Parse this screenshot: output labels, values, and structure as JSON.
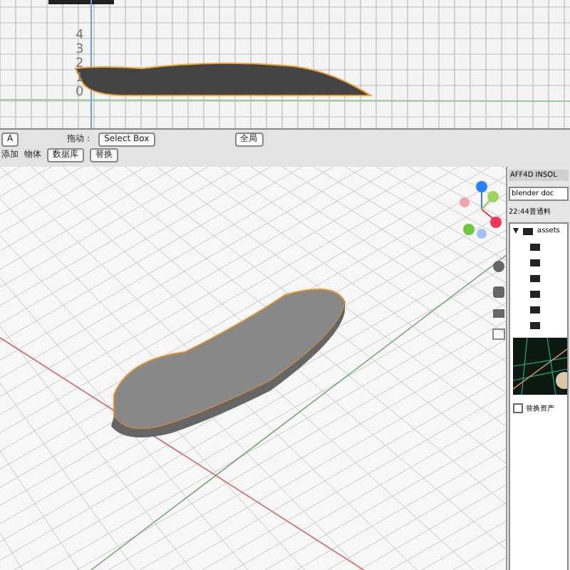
{
  "side_view": {
    "axis_labels": [
      "4",
      "3",
      "2",
      "1",
      "0"
    ]
  },
  "toolbar": {
    "mode": "A",
    "drag_label": "拖动：",
    "drag_value": "Select Box",
    "transform": "全局"
  },
  "menu": [
    "添加",
    "物体"
  ],
  "library": {
    "value": "数据库",
    "action": "替换"
  },
  "panel": {
    "title": "AFF4D INSOL",
    "file": "blender doc",
    "recent": "22:44普通料",
    "tree": [
      {
        "label": "assets",
        "expanded": true
      }
    ],
    "replace_label": "替换资产",
    "replace_checked": false
  }
}
